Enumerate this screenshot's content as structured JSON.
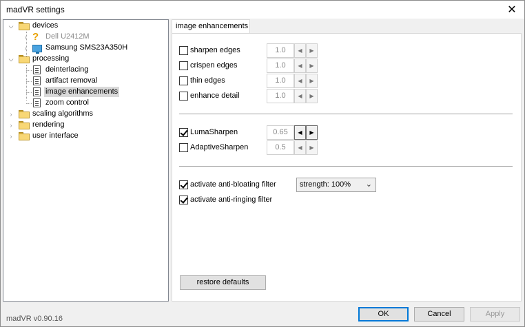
{
  "window": {
    "title": "madVR settings"
  },
  "tree": {
    "devices": "devices",
    "dell": "Dell U2412M",
    "samsung": "Samsung SMS23A350H",
    "processing": "processing",
    "deinterlacing": "deinterlacing",
    "artifact_removal": "artifact removal",
    "image_enhancements": "image enhancements",
    "zoom_control": "zoom control",
    "scaling_algorithms": "scaling algorithms",
    "rendering": "rendering",
    "user_interface": "user interface"
  },
  "tab": {
    "label": "image enhancements"
  },
  "options": {
    "sharpen_edges": {
      "label": "sharpen edges",
      "checked": false,
      "value": "1.0"
    },
    "crispen_edges": {
      "label": "crispen edges",
      "checked": false,
      "value": "1.0"
    },
    "thin_edges": {
      "label": "thin edges",
      "checked": false,
      "value": "1.0"
    },
    "enhance_detail": {
      "label": "enhance detail",
      "checked": false,
      "value": "1.0"
    },
    "luma_sharpen": {
      "label": "LumaSharpen",
      "checked": true,
      "value": "0.65"
    },
    "adaptive_sharpen": {
      "label": "AdaptiveSharpen",
      "checked": false,
      "value": "0.5"
    },
    "anti_bloating": {
      "label": "activate anti-bloating filter",
      "checked": true
    },
    "anti_ringing": {
      "label": "activate anti-ringing filter",
      "checked": true
    }
  },
  "strength": {
    "selected": "strength: 100%"
  },
  "buttons": {
    "restore_defaults": "restore defaults",
    "ok": "OK",
    "cancel": "Cancel",
    "apply": "Apply"
  },
  "footer": {
    "version": "madVR v0.90.16"
  }
}
